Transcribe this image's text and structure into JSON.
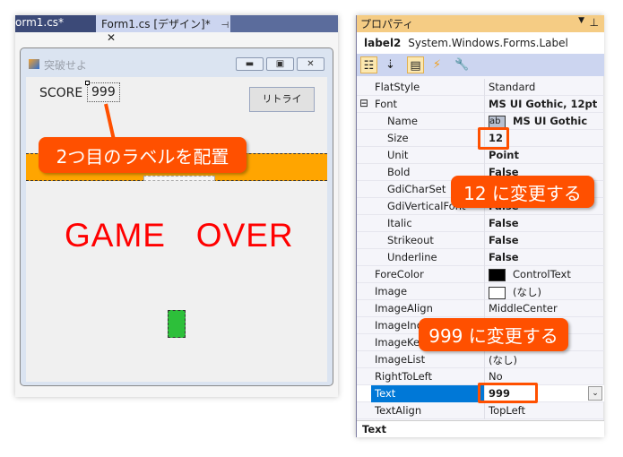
{
  "tabs": [
    {
      "label": "orm1.cs*"
    },
    {
      "label": "Form1.cs [デザイン]*",
      "pin": "ピ",
      "close": "✕"
    }
  ],
  "form": {
    "title": "突破せよ",
    "score_label": "SCORE",
    "score_value": "999",
    "retry_button": "リトライ",
    "game_over": "GAME   OVER",
    "colors": {
      "bar": "#ffa500",
      "game_over": "#ff0000",
      "block": "#2dbf3a"
    }
  },
  "callouts": {
    "label": "2つ目のラベルを配置",
    "size": "12  に変更する",
    "text": "999  に変更する",
    "color": "#ff5000"
  },
  "properties": {
    "title": "プロパティ",
    "object_name": "label2",
    "object_type": "System.Windows.Forms.Label",
    "rows": [
      {
        "name": "FlatStyle",
        "value": "Standard"
      },
      {
        "name": "Font",
        "value": "MS UI Gothic, 12pt",
        "expander": "⊟",
        "bold": true
      },
      {
        "name": "Name",
        "value": "MS UI Gothic",
        "sub": true,
        "bold": true,
        "swatch": "ab"
      },
      {
        "name": "Size",
        "value": "12",
        "sub": true,
        "bold": true
      },
      {
        "name": "Unit",
        "value": "Point",
        "sub": true,
        "bold": true
      },
      {
        "name": "Bold",
        "value": "False",
        "sub": true,
        "bold": true
      },
      {
        "name": "GdiCharSet",
        "value": "",
        "sub": true
      },
      {
        "name": "GdiVerticalFont",
        "value": "False",
        "sub": true,
        "bold": true
      },
      {
        "name": "Italic",
        "value": "False",
        "sub": true,
        "bold": true
      },
      {
        "name": "Strikeout",
        "value": "False",
        "sub": true,
        "bold": true
      },
      {
        "name": "Underline",
        "value": "False",
        "sub": true,
        "bold": true
      },
      {
        "name": "ForeColor",
        "value": "ControlText",
        "swatch": "#000000"
      },
      {
        "name": "Image",
        "value": "(なし)",
        "swatch": "#ffffff"
      },
      {
        "name": "ImageAlign",
        "value": "MiddleCenter"
      },
      {
        "name": "ImageIndex",
        "value": ""
      },
      {
        "name": "ImageKey",
        "value": ""
      },
      {
        "name": "ImageList",
        "value": "(なし)"
      },
      {
        "name": "RightToLeft",
        "value": "No"
      },
      {
        "name": "Text",
        "value": "999",
        "selected": true,
        "bold": true
      },
      {
        "name": "TextAlign",
        "value": "TopLeft"
      }
    ],
    "description": "Text"
  }
}
